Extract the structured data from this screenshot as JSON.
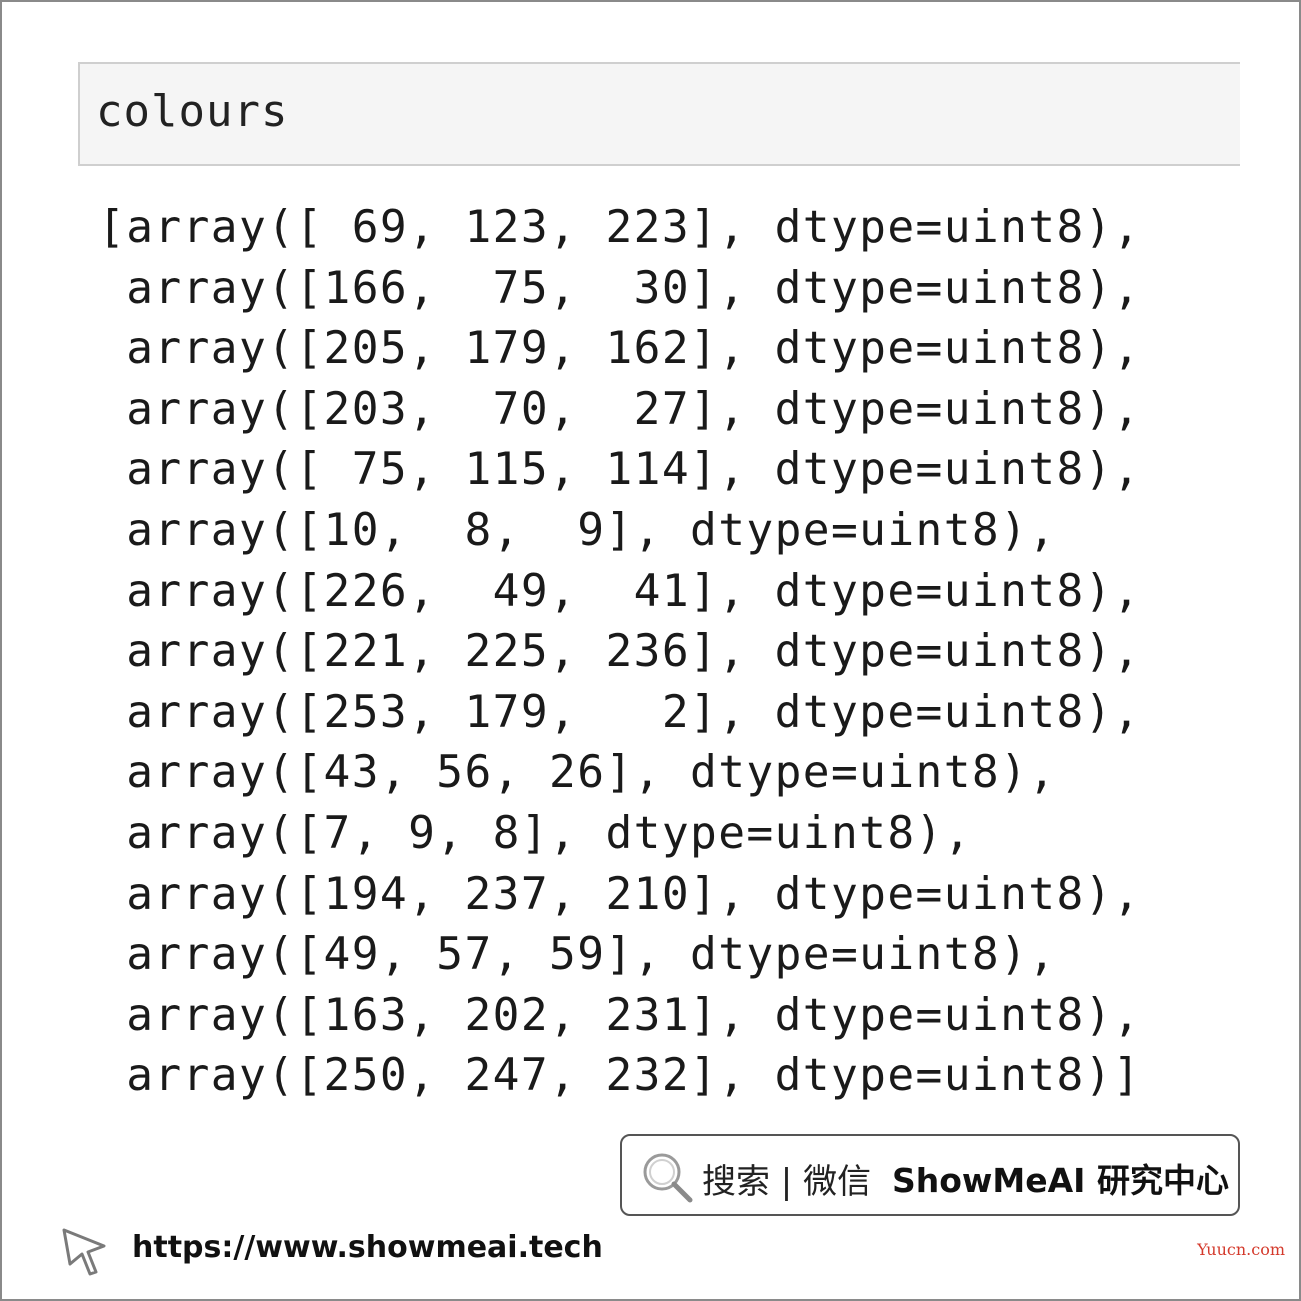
{
  "input_cell": {
    "code": "colours"
  },
  "output": {
    "lines": [
      "[array([ 69, 123, 223], dtype=uint8),",
      " array([166,  75,  30], dtype=uint8),",
      " array([205, 179, 162], dtype=uint8),",
      " array([203,  70,  27], dtype=uint8),",
      " array([ 75, 115, 114], dtype=uint8),",
      " array([10,  8,  9], dtype=uint8),",
      " array([226,  49,  41], dtype=uint8),",
      " array([221, 225, 236], dtype=uint8),",
      " array([253, 179,   2], dtype=uint8),",
      " array([43, 56, 26], dtype=uint8),",
      " array([7, 9, 8], dtype=uint8),",
      " array([194, 237, 210], dtype=uint8),",
      " array([49, 57, 59], dtype=uint8),",
      " array([163, 202, 231], dtype=uint8),",
      " array([250, 247, 232], dtype=uint8)]"
    ]
  },
  "footer": {
    "search_label": "搜索 | 微信",
    "brand_label": "ShowMeAI 研究中心",
    "url": "https://www.showmeai.tech",
    "watermark": "Yuucn.com",
    "search_icon": "magnifier-icon",
    "cursor_icon": "pointer-cursor-icon"
  },
  "colors": {
    "input_bg": "#f5f5f5",
    "input_border": "#cfcfcf",
    "watermark": "#d43a2c"
  }
}
